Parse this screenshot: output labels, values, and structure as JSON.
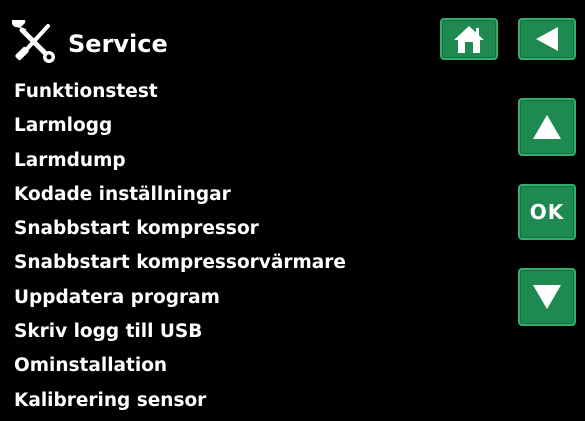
{
  "header": {
    "title": "Service",
    "icon": "wrench-screwdriver-icon"
  },
  "menu": {
    "items": [
      {
        "label": "Funktionstest"
      },
      {
        "label": "Larmlogg"
      },
      {
        "label": "Larmdump"
      },
      {
        "label": "Kodade inställningar"
      },
      {
        "label": "Snabbstart kompressor"
      },
      {
        "label": "Snabbstart kompressorvärmare"
      },
      {
        "label": "Uppdatera program"
      },
      {
        "label": "Skriv logg till USB"
      },
      {
        "label": "Ominstallation"
      },
      {
        "label": "Kalibrering sensor"
      }
    ]
  },
  "buttons": {
    "home_icon": "home-icon",
    "back_icon": "back-arrow-icon",
    "up_icon": "up-arrow-icon",
    "ok_label": "OK",
    "down_icon": "down-arrow-icon"
  },
  "colors": {
    "background": "#000000",
    "text": "#ffffff",
    "button_fill": "#1e8a52",
    "button_border": "#2fae6c"
  }
}
